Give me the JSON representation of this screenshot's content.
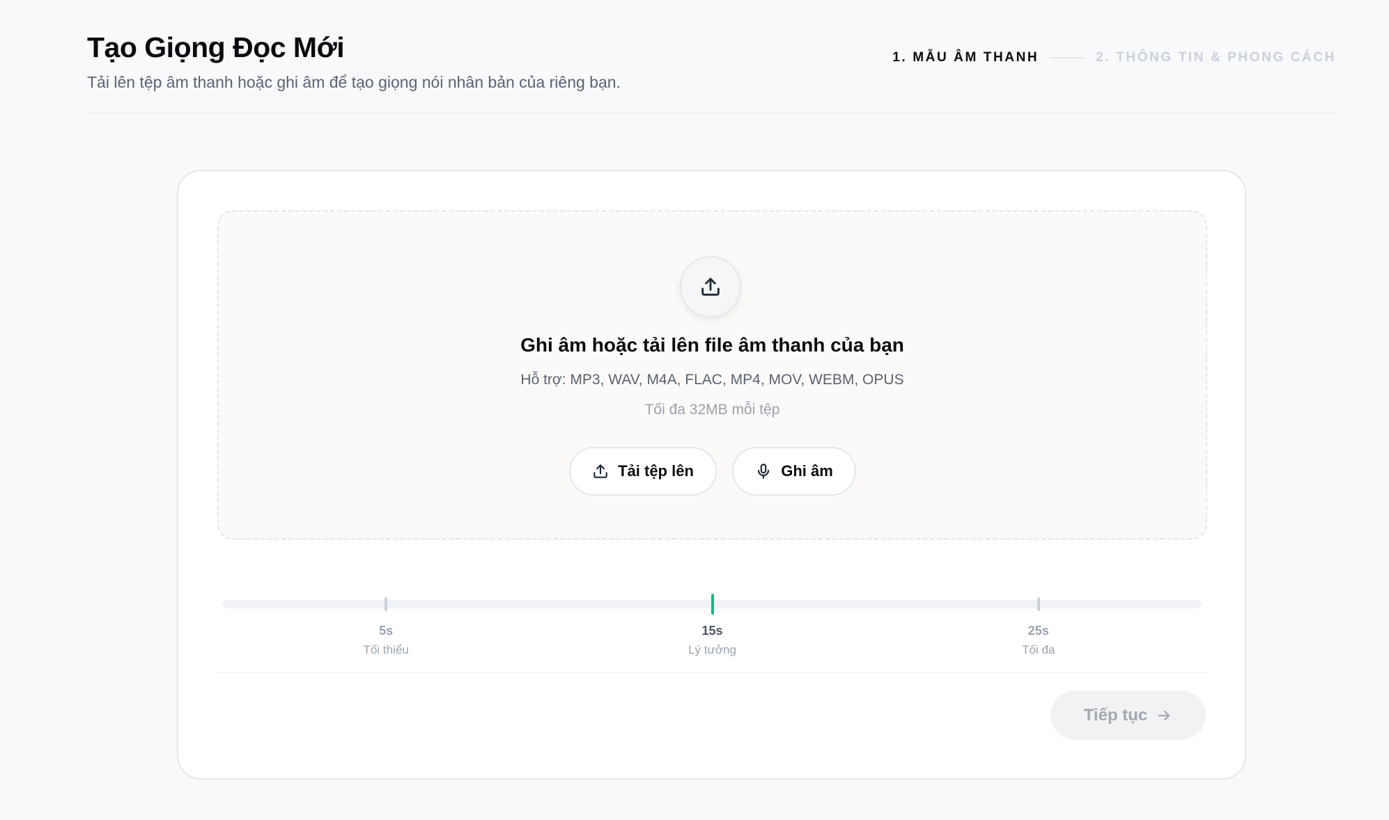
{
  "header": {
    "title": "Tạo Giọng Đọc Mới",
    "subtitle": "Tải lên tệp âm thanh hoặc ghi âm để tạo giọng nói nhân bản của riêng bạn."
  },
  "stepper": {
    "steps": [
      {
        "label": "1. MẪU ÂM THANH",
        "active": true
      },
      {
        "label": "2. THÔNG TIN & PHONG CÁCH",
        "active": false
      }
    ]
  },
  "dropzone": {
    "icon": "upload-icon",
    "title": "Ghi âm hoặc tải lên file âm thanh của bạn",
    "formats": "Hỗ trợ: MP3, WAV, M4A, FLAC, MP4, MOV, WEBM, OPUS",
    "limit": "Tối đa 32MB mỗi tệp",
    "upload_label": "Tải tệp lên",
    "record_label": "Ghi âm"
  },
  "duration_scale": {
    "min_seconds": 0,
    "max_seconds": 30,
    "markers": [
      {
        "seconds": 5,
        "value": "5s",
        "label": "Tối thiểu",
        "highlight": false
      },
      {
        "seconds": 15,
        "value": "15s",
        "label": "Lý tưởng",
        "highlight": true
      },
      {
        "seconds": 25,
        "value": "25s",
        "label": "Tối đa",
        "highlight": false
      }
    ],
    "ideal_color": "#10b981"
  },
  "footer": {
    "continue_label": "Tiếp tục",
    "continue_enabled": false
  }
}
